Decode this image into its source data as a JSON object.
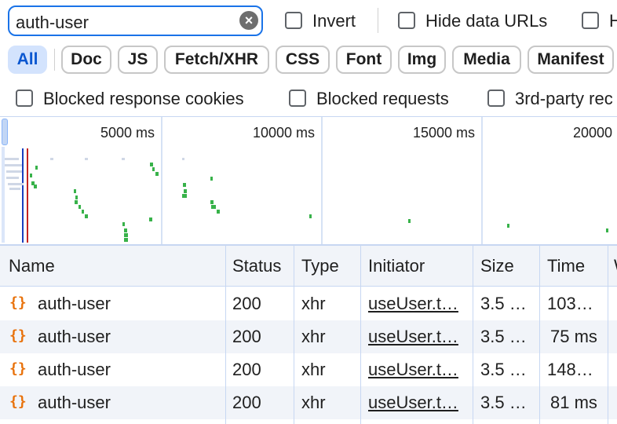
{
  "filter": {
    "value": "auth-user"
  },
  "checkboxes_row1": [
    {
      "label": "Invert"
    },
    {
      "label": "Hide data URLs"
    },
    {
      "label": "H"
    }
  ],
  "type_filters": [
    {
      "label": "All",
      "active": true
    },
    {
      "label": "Doc"
    },
    {
      "label": "JS"
    },
    {
      "label": "Fetch/XHR"
    },
    {
      "label": "CSS"
    },
    {
      "label": "Font"
    },
    {
      "label": "Img"
    },
    {
      "label": "Media"
    },
    {
      "label": "Manifest"
    }
  ],
  "checkboxes_row3": [
    {
      "label": "Blocked response cookies"
    },
    {
      "label": "Blocked requests"
    },
    {
      "label": "3rd-party rec"
    }
  ],
  "overview": {
    "ticks": [
      "5000 ms",
      "10000 ms",
      "15000 ms",
      "20000"
    ],
    "colors": {
      "request_bar": "#38b24a",
      "dom_content_loaded": "#1a3fbf",
      "load": "#c5221f"
    }
  },
  "table": {
    "columns": [
      "Name",
      "Status",
      "Type",
      "Initiator",
      "Size",
      "Time",
      "W"
    ],
    "rows": [
      {
        "icon": "fetch-xhr-icon",
        "name": "auth-user",
        "status": "200",
        "type": "xhr",
        "initiator": "useUser.t…",
        "size": "3.5 …",
        "time": "103…"
      },
      {
        "icon": "fetch-xhr-icon",
        "name": "auth-user",
        "status": "200",
        "type": "xhr",
        "initiator": "useUser.t…",
        "size": "3.5 …",
        "time": "75 ms"
      },
      {
        "icon": "fetch-xhr-icon",
        "name": "auth-user",
        "status": "200",
        "type": "xhr",
        "initiator": "useUser.t…",
        "size": "3.5 …",
        "time": "148…"
      },
      {
        "icon": "fetch-xhr-icon",
        "name": "auth-user",
        "status": "200",
        "type": "xhr",
        "initiator": "useUser.t…",
        "size": "3.5 …",
        "time": "81 ms"
      }
    ]
  },
  "icons": {
    "clear": "clear-icon",
    "xhr_glyph": "{}"
  }
}
